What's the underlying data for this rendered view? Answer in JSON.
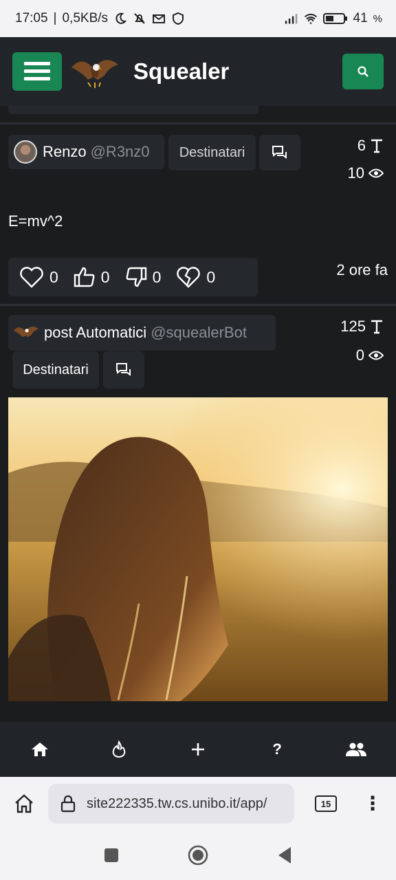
{
  "status_bar": {
    "time": "17:05",
    "speed": "0,5KB/s",
    "battery": "41"
  },
  "app": {
    "title": "Squealer"
  },
  "posts": [
    {
      "author": "Renzo",
      "handle": "@R3nz0",
      "recipients_label": "Destinatari",
      "chars": "6",
      "views": "10",
      "text": "E=mv^2",
      "reactions": {
        "heart": "0",
        "like": "0",
        "dislike": "0",
        "broken": "0"
      },
      "time": "2 ore fa"
    },
    {
      "author": "post Automatici",
      "handle": "@squealerBot",
      "recipients_label": "Destinatari",
      "chars": "125",
      "views": "0"
    }
  ],
  "bottom_nav": {
    "help": "?"
  },
  "browser": {
    "url": "site222335.tw.cs.unibo.it/app/",
    "tab_count": "15"
  }
}
